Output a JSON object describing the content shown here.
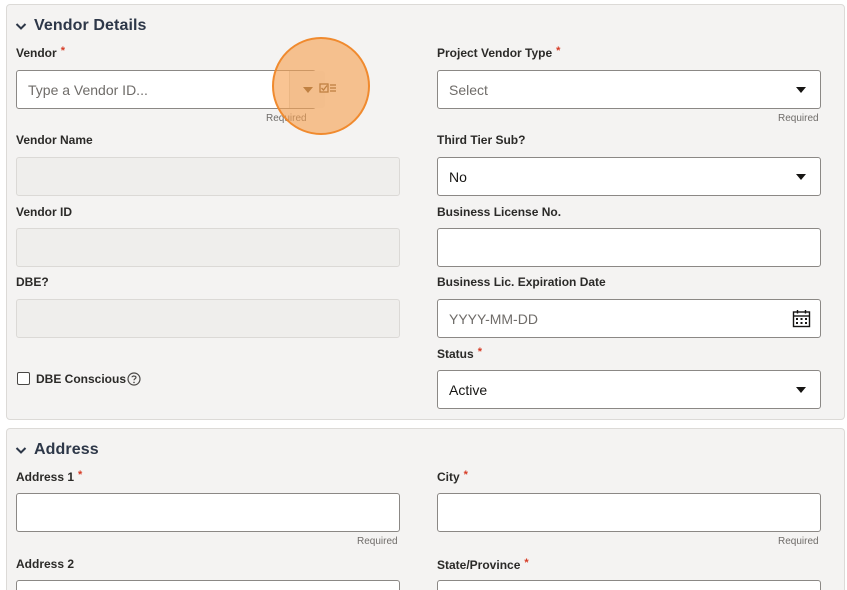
{
  "vendor_details": {
    "title": "Vendor Details",
    "vendor": {
      "label": "Vendor",
      "placeholder": "Type a Vendor ID...",
      "hint": "Required"
    },
    "project_vendor_type": {
      "label": "Project Vendor Type",
      "value": "Select",
      "hint": "Required"
    },
    "vendor_name": {
      "label": "Vendor Name"
    },
    "third_tier_sub": {
      "label": "Third Tier Sub?",
      "value": "No"
    },
    "vendor_id": {
      "label": "Vendor ID"
    },
    "business_license_no": {
      "label": "Business License No."
    },
    "dbe": {
      "label": "DBE?"
    },
    "business_lic_expiration": {
      "label": "Business Lic. Expiration Date",
      "placeholder": "YYYY-MM-DD"
    },
    "status": {
      "label": "Status",
      "value": "Active"
    },
    "dbe_conscious": {
      "label": "DBE Conscious"
    }
  },
  "address": {
    "title": "Address",
    "address1": {
      "label": "Address 1",
      "hint": "Required"
    },
    "city": {
      "label": "City",
      "hint": "Required"
    },
    "address2": {
      "label": "Address 2"
    },
    "state_province": {
      "label": "State/Province"
    }
  },
  "required_mark": "*",
  "colors": {
    "accent_highlight": "#f08a2e",
    "required": "#d63b25",
    "section_title": "#2d3748"
  },
  "icons": [
    "chevron-down-icon",
    "dropdown-arrow-icon",
    "list-select-icon",
    "calendar-icon",
    "help-icon"
  ]
}
